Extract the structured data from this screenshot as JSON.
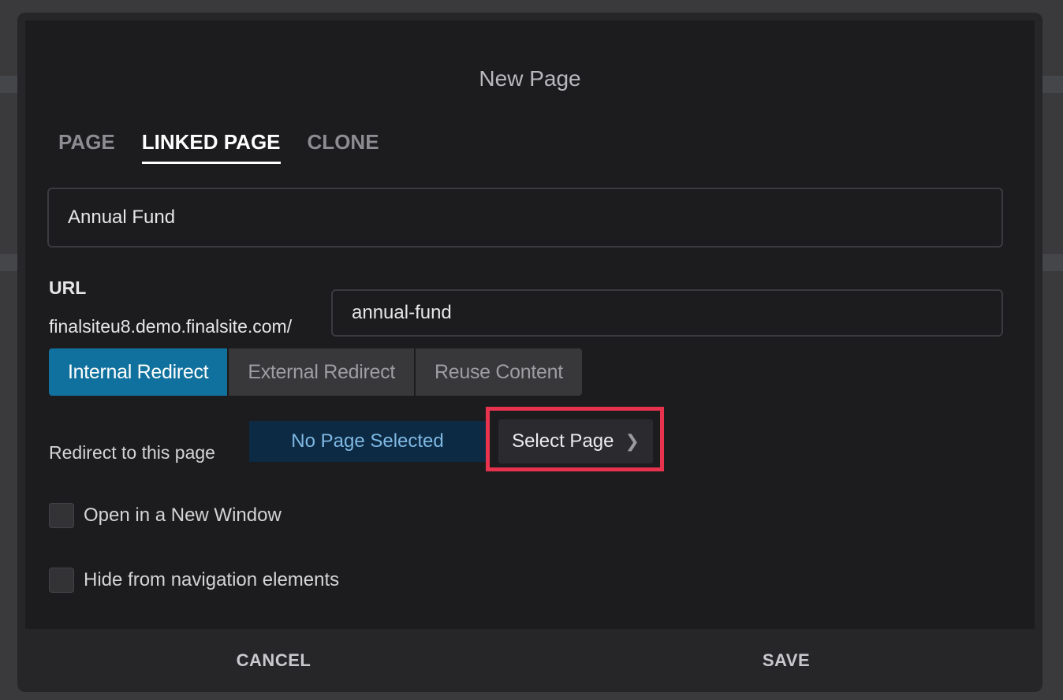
{
  "modal": {
    "title": "New Page"
  },
  "tabs": [
    {
      "label": "PAGE",
      "active": false
    },
    {
      "label": "LINKED PAGE",
      "active": true
    },
    {
      "label": "CLONE",
      "active": false
    }
  ],
  "form": {
    "title_value": "Annual Fund",
    "url_label": "URL",
    "url_prefix": "finalsiteu8.demo.finalsite.com/",
    "url_slug": "annual-fund"
  },
  "redirect_types": [
    {
      "label": "Internal Redirect",
      "active": true
    },
    {
      "label": "External Redirect",
      "active": false
    },
    {
      "label": "Reuse Content",
      "active": false
    }
  ],
  "redirect": {
    "label": "Redirect to this page",
    "selected_page": "No Page Selected",
    "select_button": "Select Page"
  },
  "options": {
    "open_new_window": "Open in a New Window",
    "hide_from_nav": "Hide from navigation elements"
  },
  "footer": {
    "cancel": "CANCEL",
    "save": "SAVE"
  },
  "colors": {
    "accent": "#11719e",
    "highlight": "#e8334f",
    "selected_page_bg": "#0c2a43",
    "selected_page_text": "#7fb8e4"
  }
}
